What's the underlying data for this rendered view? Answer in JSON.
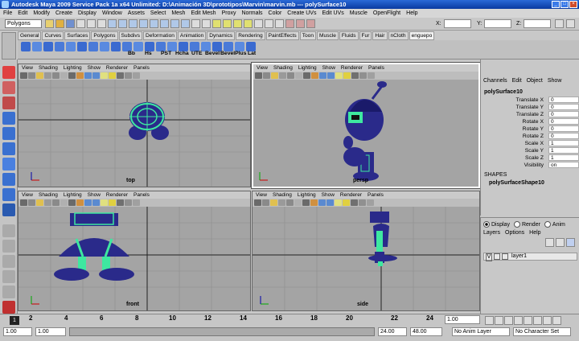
{
  "window": {
    "title": "Autodesk Maya 2009 Service Pack 1a x64 Unlimited: D:\\Animación 3D\\prototipos\\Marvin\\marvin.mb  ---  polySurface10",
    "buttons": [
      "_",
      "□",
      "×"
    ]
  },
  "menubar": [
    "File",
    "Edit",
    "Modify",
    "Create",
    "Display",
    "Window",
    "Assets",
    "Select",
    "Mesh",
    "Edit Mesh",
    "Proxy",
    "Normals",
    "Color",
    "Create UVs",
    "Edit UVs",
    "Muscle",
    "OpenFlight",
    "Help"
  ],
  "statusline": {
    "mode": "Polygons",
    "x_label": "X:",
    "y_label": "Y:",
    "z_label": "Z:"
  },
  "shelf": {
    "tabs": [
      "General",
      "Curves",
      "Surfaces",
      "Polygons",
      "Subdivs",
      "Deformation",
      "Animation",
      "Dynamics",
      "Rendering",
      "PaintEffects",
      "Toon",
      "Muscle",
      "Fluids",
      "Fur",
      "Hair",
      "nCloth",
      "enguepo"
    ],
    "active_tab": "enguepo",
    "item_text": [
      "Bb",
      "Hs",
      "PST",
      "Hcha",
      "UTE",
      "BeveI",
      "BevelPlus",
      "Lat"
    ]
  },
  "viewports": {
    "menu": [
      "View",
      "Shading",
      "Lighting",
      "Show",
      "Renderer",
      "Panels"
    ],
    "top_label": "top",
    "persp_label": "persp",
    "front_label": "front",
    "side_label": "side"
  },
  "channelbox": {
    "menu": [
      "Channels",
      "Edit",
      "Object",
      "Show"
    ],
    "object": "polySurface10",
    "channels": [
      {
        "name": "Translate X",
        "value": "0"
      },
      {
        "name": "Translate Y",
        "value": "0"
      },
      {
        "name": "Translate Z",
        "value": "0"
      },
      {
        "name": "Rotate X",
        "value": "0"
      },
      {
        "name": "Rotate Y",
        "value": "0"
      },
      {
        "name": "Rotate Z",
        "value": "0"
      },
      {
        "name": "Scale X",
        "value": "1"
      },
      {
        "name": "Scale Y",
        "value": "1"
      },
      {
        "name": "Scale Z",
        "value": "1"
      },
      {
        "name": "Visibility",
        "value": "on"
      }
    ],
    "shapes_header": "SHAPES",
    "shape_name": "polySurfaceShape10"
  },
  "layers": {
    "tabs": [
      "Display",
      "Render",
      "Anim"
    ],
    "selected_tab": "Display",
    "menu": [
      "Layers",
      "Options",
      "Help"
    ],
    "layer_v": "V",
    "layer_name": "layer1"
  },
  "timeline": {
    "ticks": [
      "1",
      "2",
      "4",
      "6",
      "8",
      "10",
      "12",
      "14",
      "16",
      "18",
      "20",
      "22",
      "24"
    ],
    "current_frame": "1",
    "current_field": "1.00"
  },
  "range": {
    "start": "1.00",
    "playback_start": "1.00",
    "playback_end": "24.00",
    "end": "48.00",
    "anim_layer": "No Anim Layer",
    "character_set": "No Character Set"
  },
  "colors": {
    "accent": "#2a6ad8",
    "wire": "#1a1a8a",
    "selected_wire": "#3ee8a0",
    "viewport_bg": "#a4a4a4"
  }
}
